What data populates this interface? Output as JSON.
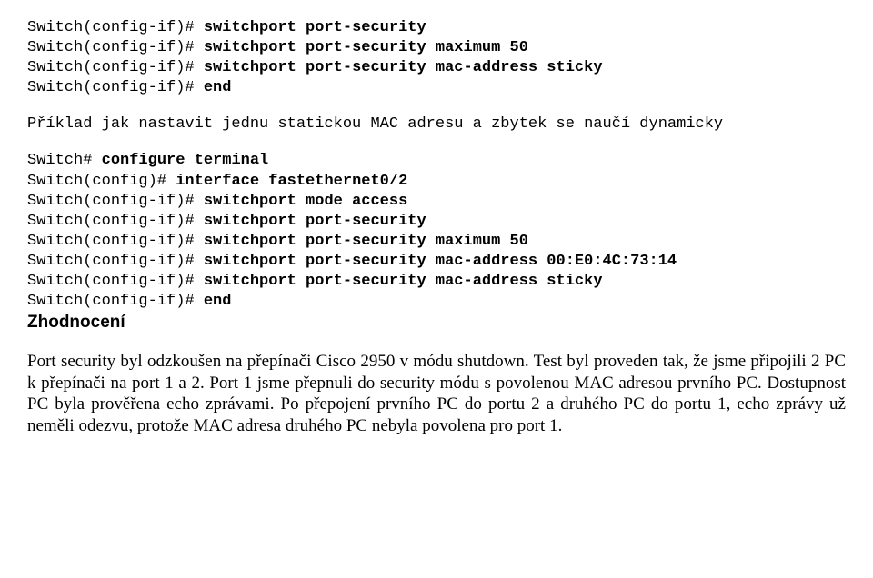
{
  "block1": {
    "prompt": "Switch(config-if)# ",
    "cmd1": "switchport port-security",
    "cmd2": "switchport port-security maximum 50",
    "cmd3": "switchport port-security mac-address sticky",
    "cmd4": "end"
  },
  "intro": "Příklad jak nastavit jednu statickou MAC adresu a zbytek se naučí dynamicky",
  "block2": {
    "line1_prompt": "Switch# ",
    "line1_cmd": "configure terminal",
    "line2_prompt": "Switch(config)# ",
    "line2_cmd": "interface fastethernet0/2",
    "line3_prompt": "Switch(config-if)# ",
    "line3_cmd": "switchport mode access",
    "cmd4": "switchport port-security",
    "cmd5": "switchport port-security maximum 50",
    "cmd6": "switchport port-security mac-address 00:E0:4C:73:14",
    "cmd7": "switchport port-security mac-address sticky",
    "cmd8": "end"
  },
  "heading": "Zhodnocení",
  "paragraph": "Port security byl odzkoušen na přepínači Cisco 2950 v módu shutdown. Test byl proveden tak, že jsme připojili 2 PC k přepínači na port 1 a 2. Port 1 jsme přepnuli do security módu s povolenou MAC adresou prvního PC. Dostupnost PC byla prověřena echo zprávami. Po přepojení prvního PC do portu 2 a druhého PC do portu 1, echo zprávy už neměli odezvu, protože MAC adresa druhého PC nebyla povolena pro port 1."
}
